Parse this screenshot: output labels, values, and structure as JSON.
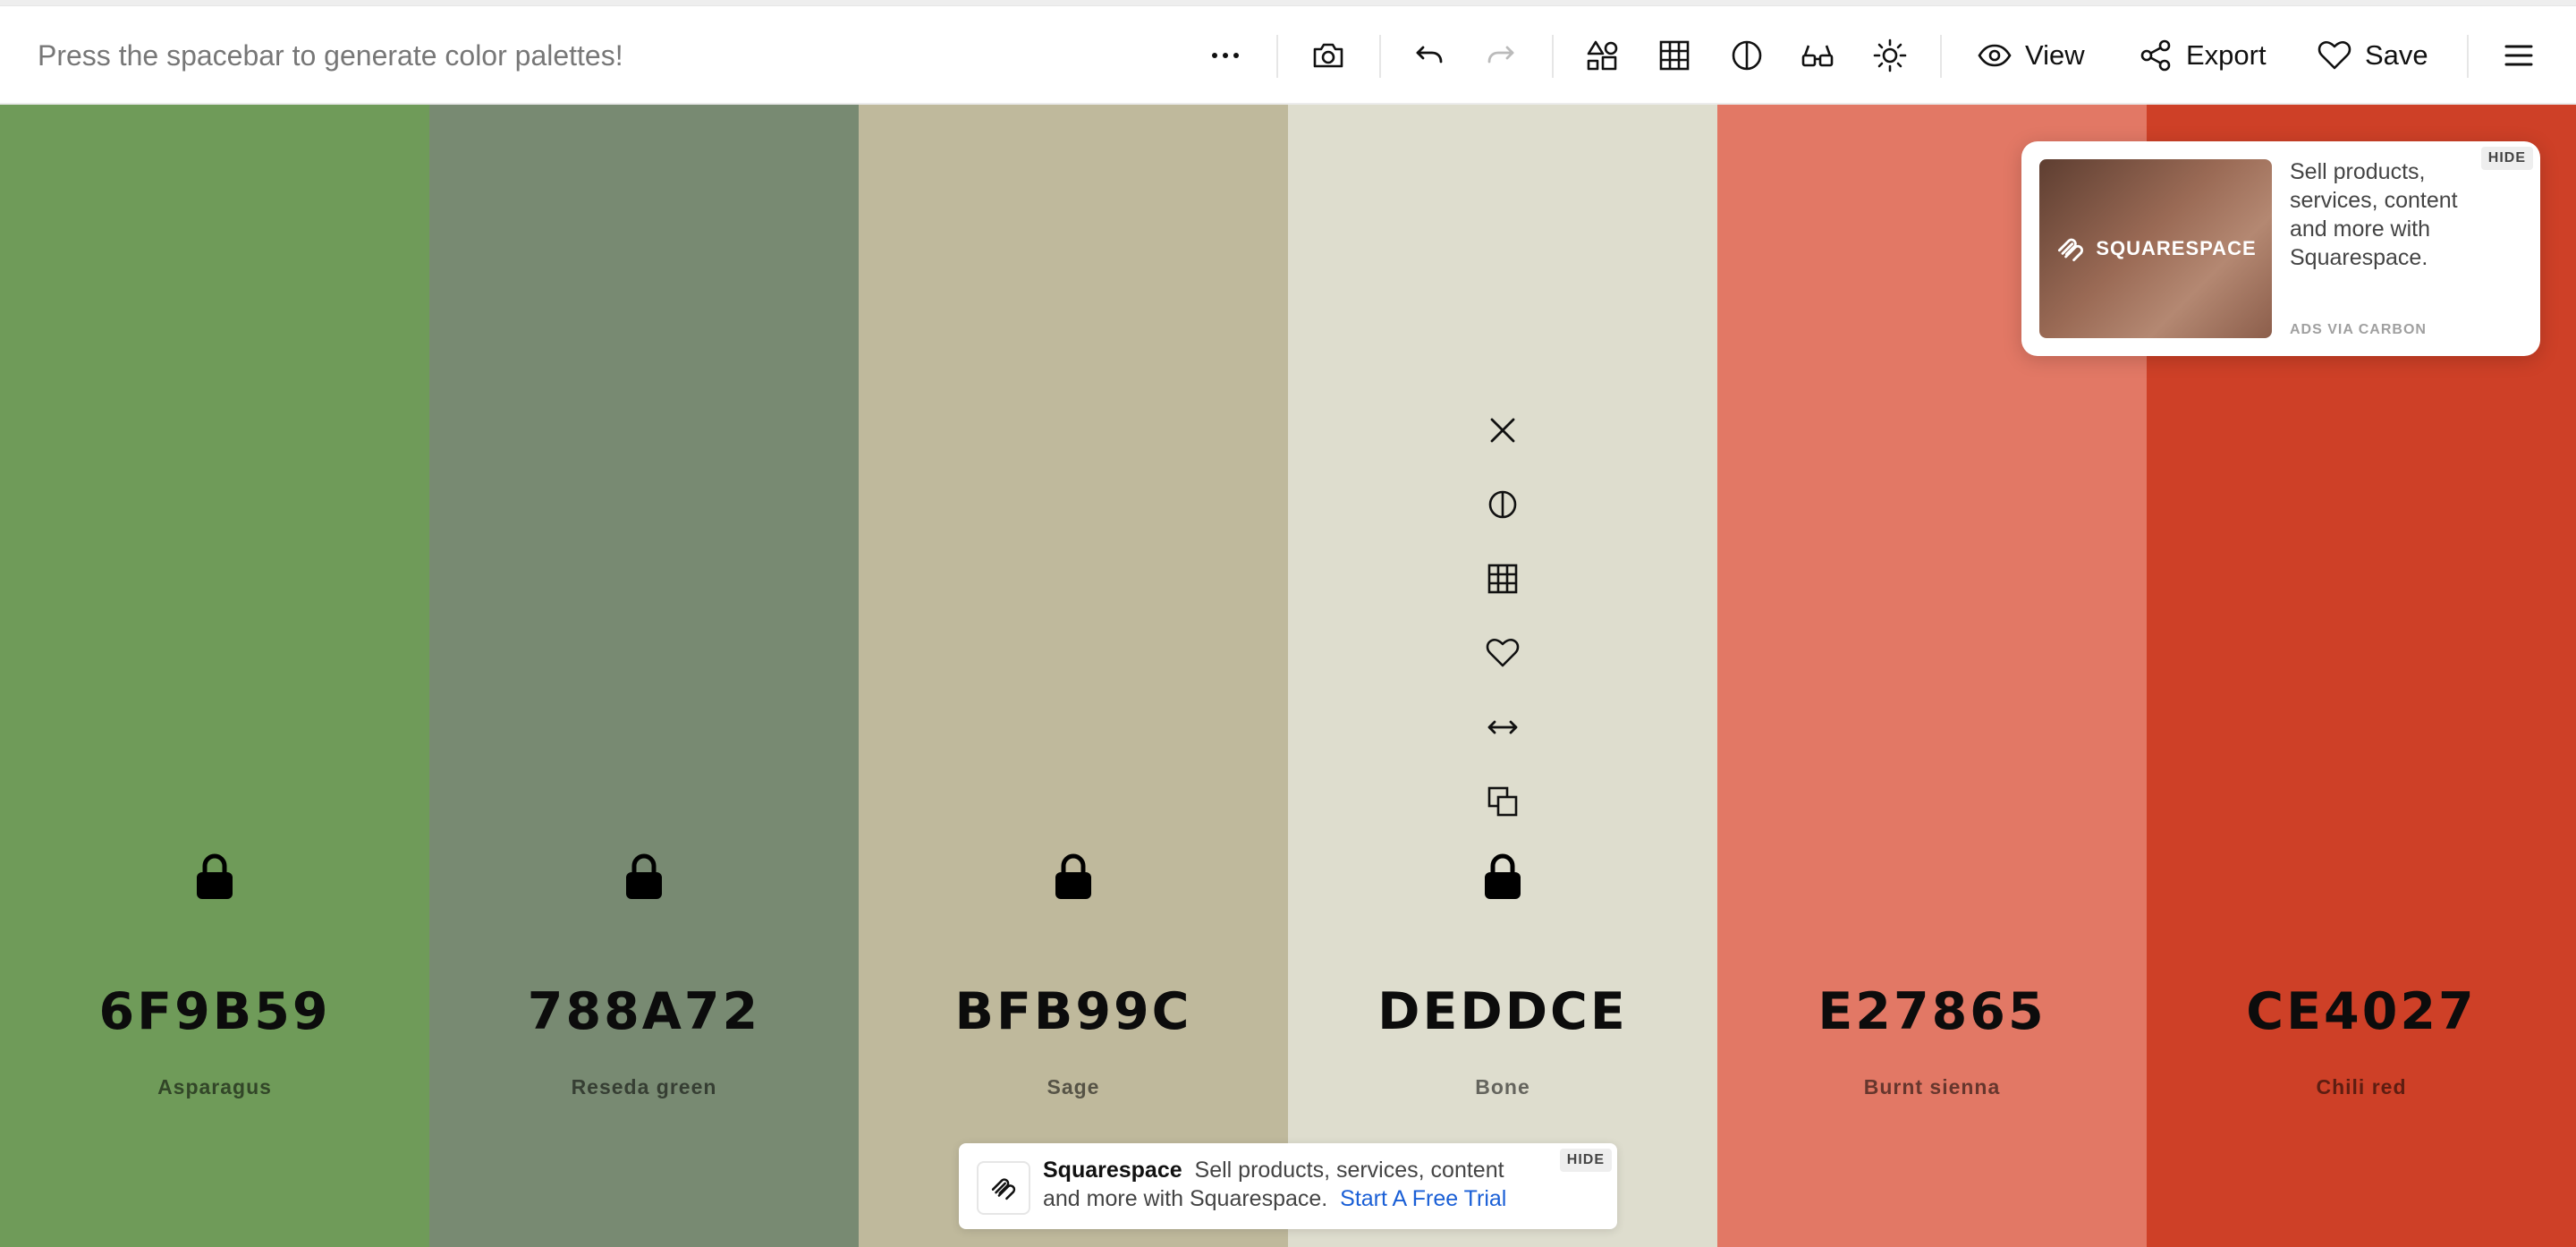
{
  "toolbar": {
    "hint": "Press the spacebar to generate color palettes!",
    "view_label": "View",
    "export_label": "Export",
    "save_label": "Save"
  },
  "palette": {
    "colors": [
      {
        "hex": "6F9B59",
        "name": "Asparagus",
        "color": "#6F9B59"
      },
      {
        "hex": "788A72",
        "name": "Reseda green",
        "color": "#788A72"
      },
      {
        "hex": "BFB99C",
        "name": "Sage",
        "color": "#BFB99C"
      },
      {
        "hex": "DEDDCE",
        "name": "Bone",
        "color": "#DEDDCE"
      },
      {
        "hex": "E27865",
        "name": "Burnt sienna",
        "color": "#E27865"
      },
      {
        "hex": "CE4027",
        "name": "Chili red",
        "color": "#CE4027"
      }
    ]
  },
  "ad_card": {
    "logo_text": "SQUARESPACE",
    "text": "Sell products, services, content and more with Squarespace.",
    "via": "ADS VIA CARBON",
    "hide": "HIDE"
  },
  "bottom_ad": {
    "brand": "Squarespace",
    "text": "Sell products, services, content and more with Squarespace.",
    "cta": "Start A Free Trial",
    "hide": "HIDE"
  }
}
